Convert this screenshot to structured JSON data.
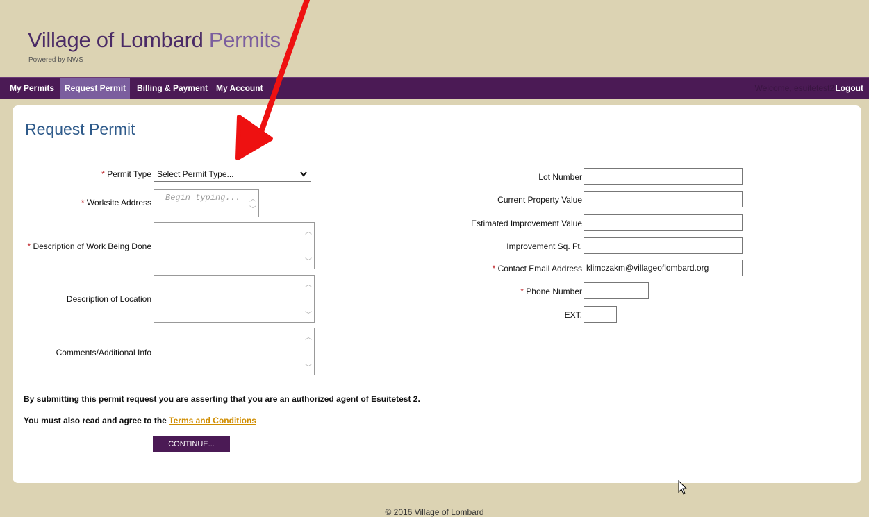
{
  "header": {
    "title_main": "Village of Lombard",
    "title_accent": "Permits",
    "subtitle": "Powered by NWS"
  },
  "nav": {
    "items": [
      {
        "label": "My Permits"
      },
      {
        "label": "Request Permit"
      },
      {
        "label": "Billing & Payment"
      },
      {
        "label": "My Account"
      }
    ],
    "welcome": "Welcome, esuitetest2",
    "logout": "Logout"
  },
  "page": {
    "heading": "Request Permit"
  },
  "form": {
    "permit_type": {
      "label": "Permit Type",
      "value": "Select Permit Type..."
    },
    "worksite_address": {
      "label": "Worksite Address",
      "placeholder": "Begin typing..."
    },
    "work_description": {
      "label": "Description of Work Being Done"
    },
    "location_description": {
      "label": "Description of Location"
    },
    "comments": {
      "label": "Comments/Additional Info"
    },
    "lot_number": {
      "label": "Lot Number",
      "value": ""
    },
    "current_property_value": {
      "label": "Current Property Value",
      "value": ""
    },
    "estimated_improvement_value": {
      "label": "Estimated Improvement Value",
      "value": ""
    },
    "improvement_sqft": {
      "label": "Improvement Sq. Ft.",
      "value": ""
    },
    "contact_email": {
      "label": "Contact Email Address",
      "value": "klimczakm@villageoflombard.org"
    },
    "phone_number": {
      "label": "Phone Number",
      "value": ""
    },
    "ext": {
      "label": "EXT.",
      "value": ""
    },
    "required_marker": "*"
  },
  "notes": {
    "agent_statement": "By submitting this permit request you are asserting that you are an authorized agent of Esuitetest 2.",
    "terms_prefix": "You must also read and agree to the",
    "terms_link": "Terms and Conditions"
  },
  "actions": {
    "continue_label": "CONTINUE..."
  },
  "footer": {
    "copyright": "© 2016 Village of Lombard"
  },
  "annotation": {
    "arrow_color": "#ee1111"
  },
  "icons": [
    "chevron-down-icon",
    "scroll-up-icon",
    "scroll-down-icon",
    "mouse-cursor-icon",
    "red-arrow-icon"
  ]
}
